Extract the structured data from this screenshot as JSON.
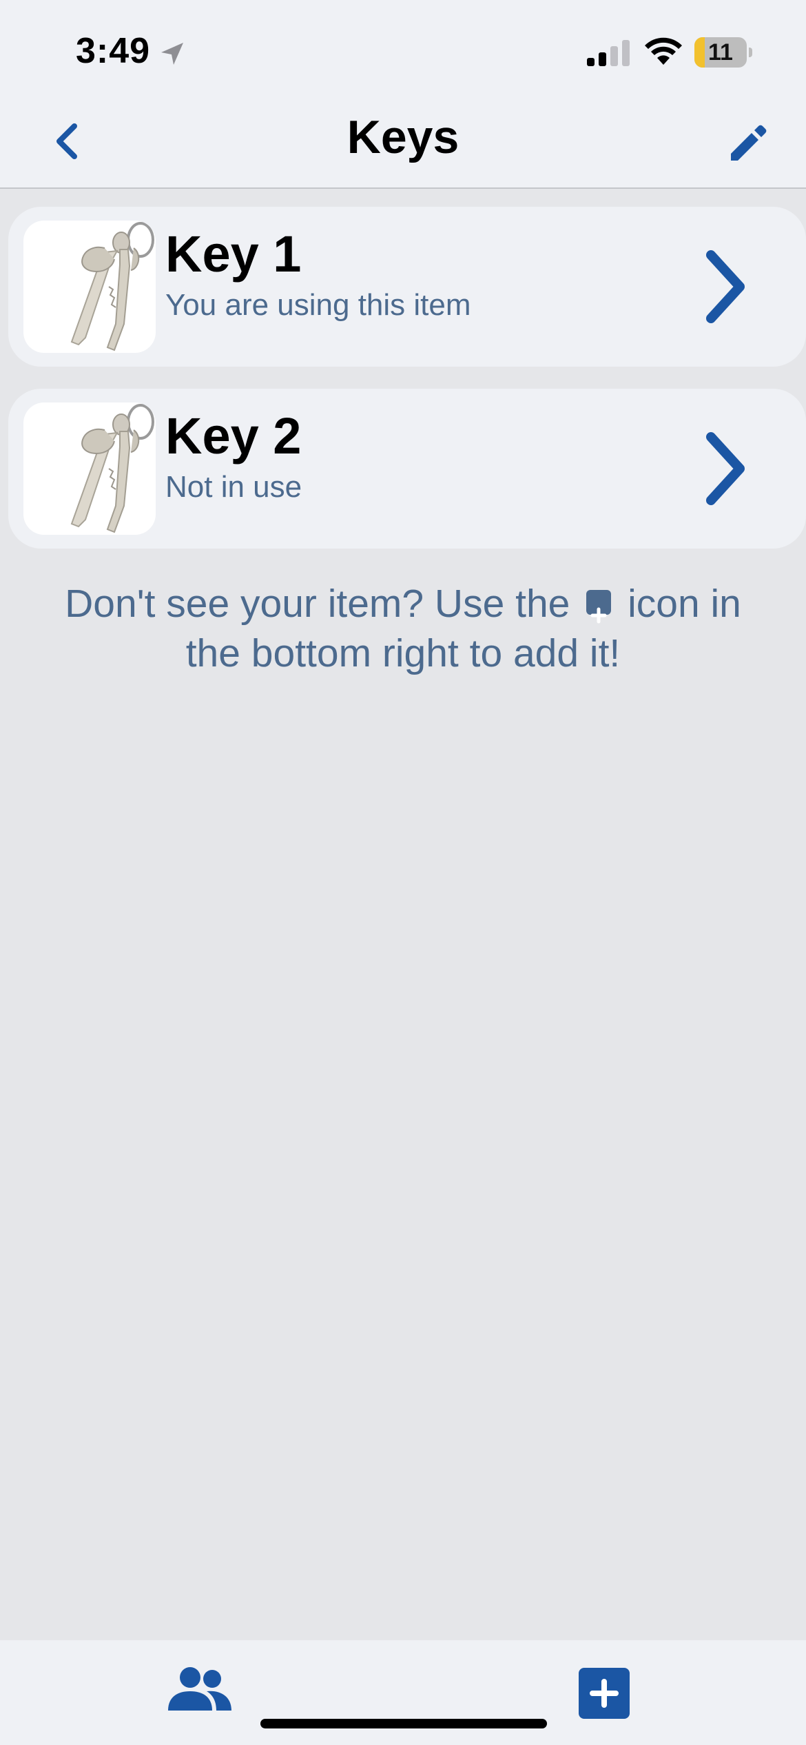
{
  "status_bar": {
    "time": "3:49",
    "battery_level": "11",
    "battery_fraction": 0.2
  },
  "header": {
    "title": "Keys"
  },
  "items": [
    {
      "title": "Key 1",
      "subtitle": "You are using this item"
    },
    {
      "title": "Key 2",
      "subtitle": "Not in use"
    }
  ],
  "hint": {
    "before_icon": "Don't see your item? Use the",
    "after_icon": "icon in the bottom right to add it!"
  },
  "icons": {
    "back": "chevron-left-icon",
    "edit": "pencil-icon",
    "row_chevron": "chevron-right-icon",
    "people": "people-icon",
    "add": "plus-square-icon"
  },
  "colors": {
    "accent": "#1b56a4",
    "subtitle": "#4c6a8e",
    "battery_low": "#f2c12e"
  }
}
